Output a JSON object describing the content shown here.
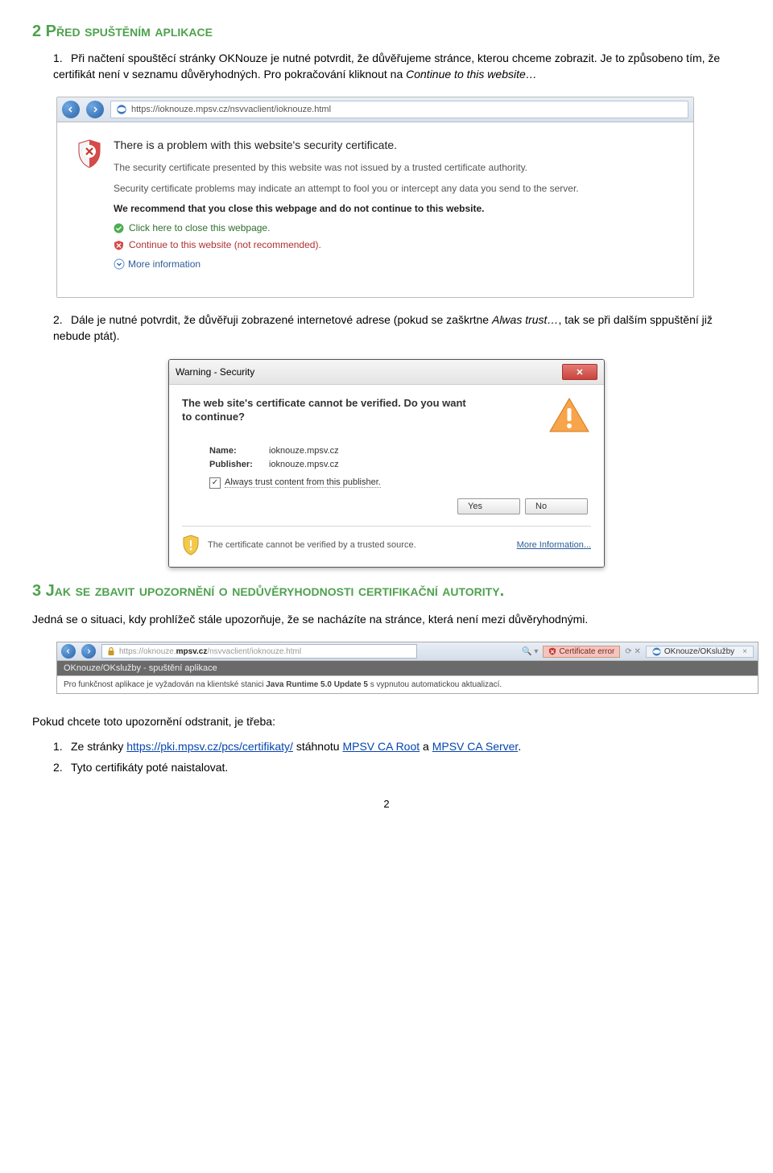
{
  "section2": {
    "heading": "2  Před spuštěním aplikace",
    "item1_text_a": "Při načtení spouštěcí stránky OKNouze je nutné potvrdit, že důvěřujeme stránce, kterou chceme zobrazit. Je to způsobeno tím, že certifikát není v seznamu důvěryhodných. Pro pokračování kliknout na ",
    "item1_italic": "Continue to this website…",
    "item2_text_a": "Dále je nutné potvrdit, že důvěřuji zobrazené internetové adrese (pokud se zaškrtne ",
    "item2_italic": "Alwas trust…",
    "item2_text_b": ", tak se při dalším sppuštění již nebude ptát)."
  },
  "ie": {
    "url": "https://ioknouze.mpsv.cz/nsvvaclient/ioknouze.html",
    "head": "There is a problem with this website's security certificate.",
    "line1": "The security certificate presented by this website was not issued by a trusted certificate authority.",
    "line2": "Security certificate problems may indicate an attempt to fool you or intercept any data you send to the server.",
    "rec": "We recommend that you close this webpage and do not continue to this website.",
    "close": "Click here to close this webpage.",
    "cont": "Continue to this website (not recommended).",
    "more": "More information"
  },
  "java": {
    "title": "Warning - Security",
    "question": "The web site's certificate cannot be verified. Do you want to continue?",
    "name_label": "Name:",
    "name_value": "ioknouze.mpsv.cz",
    "pub_label": "Publisher:",
    "pub_value": "ioknouze.mpsv.cz",
    "always": "Always trust content from this publisher.",
    "yes": "Yes",
    "no": "No",
    "bottom": "The certificate cannot be verified by a trusted source.",
    "moreinfo": "More Information..."
  },
  "section3": {
    "heading": "3  Jak se zbavit upozornění o nedůvěryhodnosti certifikační autority.",
    "para": "Jedná se o situaci, kdy prohlížeč stále upozorňuje, že se nacházíte na stránce, která není mezi důvěryhodnými."
  },
  "mini": {
    "url_gray": "https://oknouze.",
    "url_bold": "mpsv.cz",
    "url_rest": "/nsvvaclient/ioknouze.html",
    "cert_err": "Certificate error",
    "tab": "OKnouze/OKslužby",
    "subtitle": "OKnouze/OKslužby - spuštění aplikace",
    "info_a": "Pro funkčnost aplikace je vyžadován na klientské stanici ",
    "info_b": "Java Runtime 5.0 Update 5",
    "info_c": " s vypnutou automatickou aktualizací."
  },
  "after": {
    "lead": "Pokud chcete toto upozornění odstranit, je třeba:",
    "item1_a": "Ze stránky ",
    "item1_link": "https://pki.mpsv.cz/pcs/certifikaty/",
    "item1_b": " stáhnotu ",
    "item1_link2": "MPSV CA Root",
    "item1_c": " a ",
    "item1_link3": "MPSV CA Server",
    "item1_d": ".",
    "item2": "Tyto certifikáty poté naistalovat."
  },
  "page_num": "2"
}
